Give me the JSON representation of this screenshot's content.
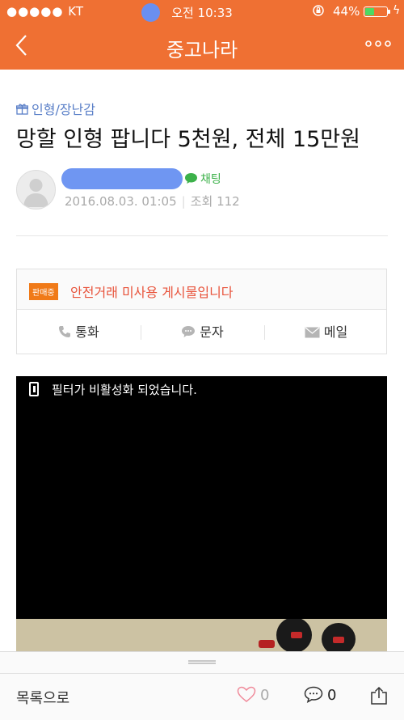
{
  "status_bar": {
    "carrier": "●●●●● KT",
    "time": "오전 10:33",
    "battery": "44%",
    "battery_level": 0.44
  },
  "navbar": {
    "title": "중고나라",
    "more": "ooo"
  },
  "post": {
    "category": "인형/장난감",
    "title": "망할 인형 팝니다 5천원, 전체 15만원",
    "chat_label": "채팅",
    "date": "2016.08.03. 01:05",
    "views": "조회 112"
  },
  "sale": {
    "badge": "판매중",
    "notice": "안전거래 미사용 게시물입니다",
    "actions": {
      "call": "통화",
      "sms": "문자",
      "mail": "메일"
    }
  },
  "media": {
    "filter_notice": "필터가 비활성화 되었습니다."
  },
  "bottom_bar": {
    "list_button": "목록으로",
    "like_count": "0",
    "comment_count": "0"
  },
  "colors": {
    "header": "#ef7033",
    "accent_blue": "#5b80c8",
    "chat_green": "#3cb14a",
    "sale_red": "#e8523a",
    "badge_orange": "#f07a18"
  }
}
